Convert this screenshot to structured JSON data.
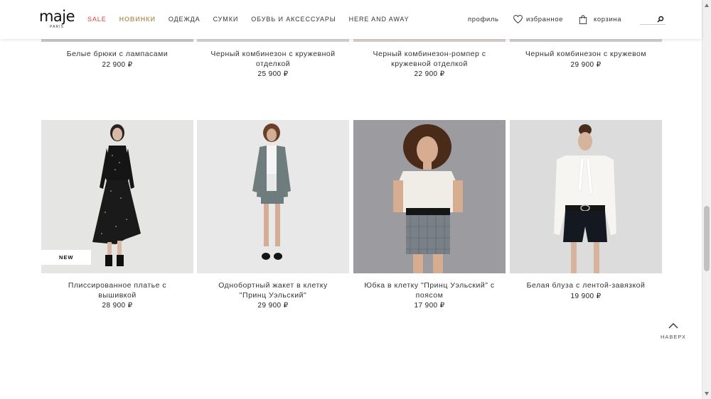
{
  "header": {
    "logo": "maje",
    "logo_sub": "PARIS",
    "nav": [
      "SALE",
      "НОВИНКИ",
      "ОДЕЖДА",
      "СУМКИ",
      "ОБУВЬ И АКСЕССУАРЫ",
      "HERE AND AWAY"
    ],
    "profile": "профиль",
    "favorites": "избранное",
    "cart": "корзина"
  },
  "products_top": [
    {
      "name": "Белые брюки с лампасами",
      "price": "22 900 ₽"
    },
    {
      "name": "Черный комбинезон с кружевной отделкой",
      "price": "25 900 ₽"
    },
    {
      "name": "Черный комбинезон-ромпер с кружевной отделкой",
      "price": "22 900 ₽"
    },
    {
      "name": "Черный комбинезон с кружевом",
      "price": "29 900 ₽"
    }
  ],
  "products": [
    {
      "name": "Плиссированное платье с вышивкой",
      "price": "28 900 ₽",
      "badge": "NEW"
    },
    {
      "name": "Однобортный жакет в клетку \"Принц Уэльский\"",
      "price": "29 900 ₽"
    },
    {
      "name": "Юбка в клетку \"Принц Уэльский\" с поясом",
      "price": "17 900 ₽"
    },
    {
      "name": "Белая блуза с лентой-завязкой",
      "price": "19 900 ₽"
    }
  ],
  "to_top": "НАВЕРХ",
  "colors": {
    "sale": "#e23b3b",
    "new": "#b59b6b"
  }
}
